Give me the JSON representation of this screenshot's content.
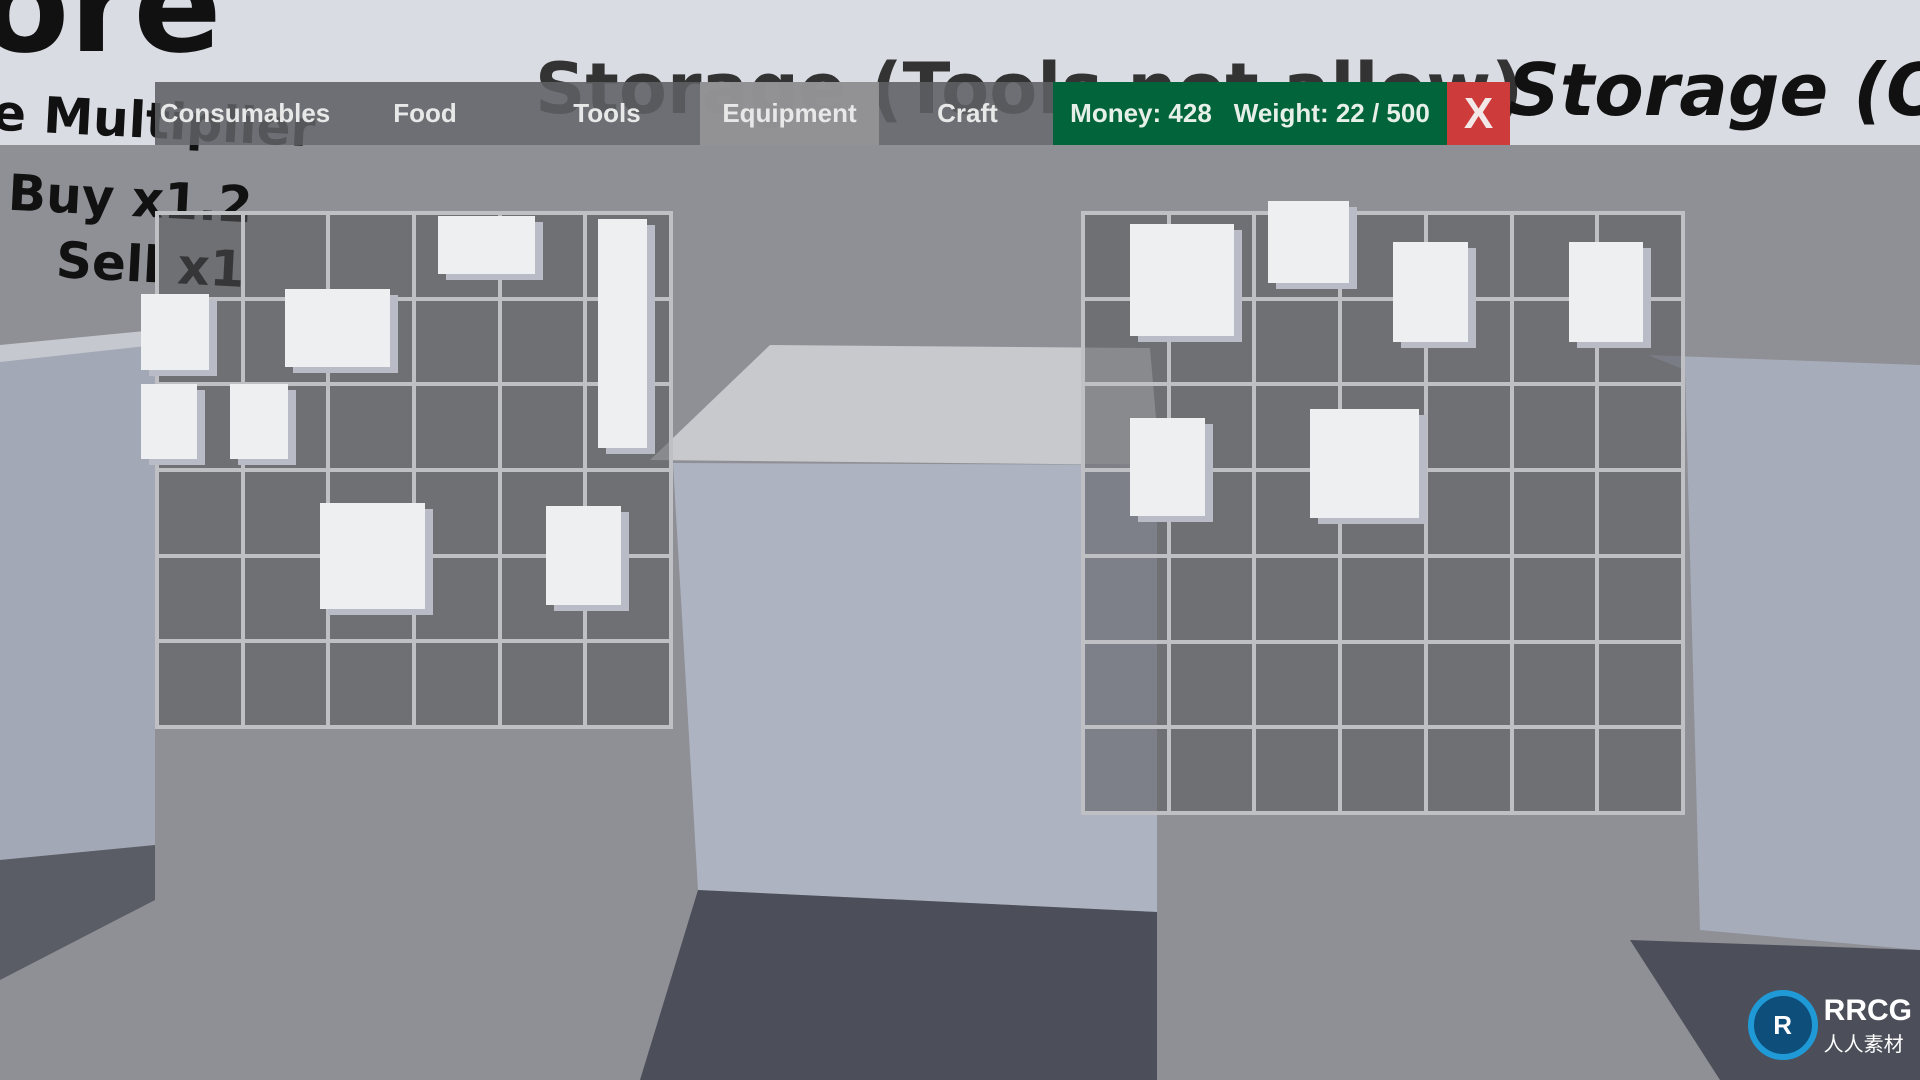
{
  "world_text": {
    "store_title": "ore",
    "multiplier_label": "e Multiplier",
    "buy": "Buy x1.2",
    "sell": "Sell x1",
    "storage_left": "Storage (Tools not allow)",
    "storage_right": "Storage (On"
  },
  "tabs": [
    {
      "label": "Consumables",
      "active": false
    },
    {
      "label": "Food",
      "active": false
    },
    {
      "label": "Tools",
      "active": false
    },
    {
      "label": "Equipment",
      "active": true
    },
    {
      "label": "Craft",
      "active": false
    }
  ],
  "stats": {
    "money": "Money: 428",
    "weight": "Weight: 22 / 500"
  },
  "close_label": "X",
  "grids": {
    "left": {
      "cols": 6,
      "rows": 6
    },
    "right": {
      "cols": 7,
      "rows": 7
    }
  },
  "colors": {
    "stats_bg": "#02643a",
    "close_bg": "#cd3b3b",
    "tab_active": "#969698"
  },
  "logo": {
    "text": "RRCG",
    "sub": "人人素材"
  }
}
